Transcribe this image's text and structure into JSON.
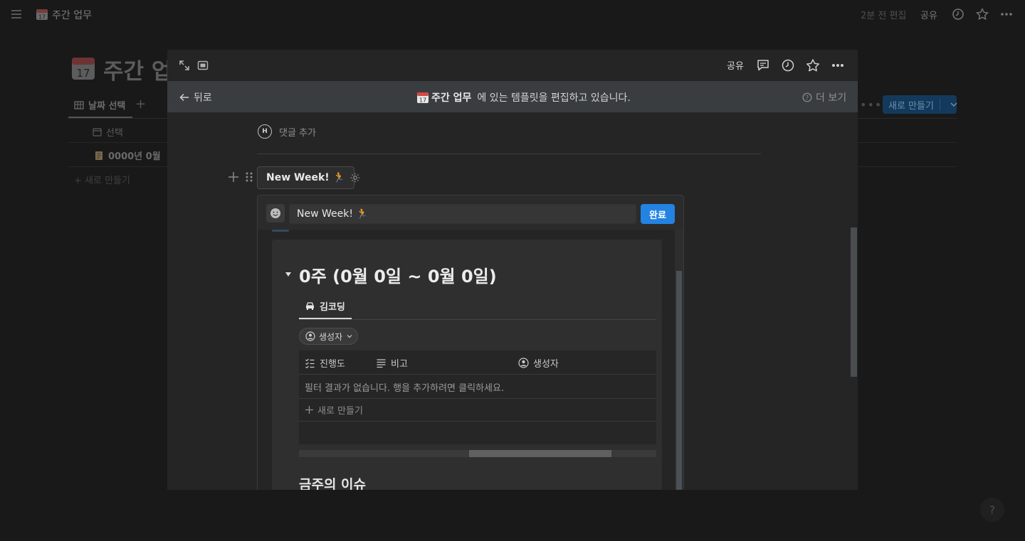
{
  "background": {
    "topbar": {
      "page_title": "주간 업무",
      "edited": "2분 전 편집",
      "share": "공유"
    },
    "page_title_big": "주간 업",
    "view_tab": "날짜 선택",
    "column_header": "선택",
    "row_title": "0000년 0월",
    "new_row": "새로 만들기",
    "new_button": "새로 만들기",
    "help": "?"
  },
  "modal": {
    "topbar": {
      "share": "공유"
    },
    "template_bar": {
      "back": "뒤로",
      "page_name": "주간 업무",
      "message": "에 있는 템플릿을 편집하고 있습니다.",
      "more": "더 보기"
    },
    "comment": {
      "avatar_initial": "H",
      "placeholder": "댓글 추가"
    },
    "template_button": {
      "label": "New Week! 🏃"
    },
    "editor": {
      "title_value": "New Week! 🏃",
      "done": "완료",
      "heading": "0주 (0월 0일 ~ 0월 0일)",
      "view_tab": "김코딩",
      "filter": "생성자",
      "columns": [
        "진행도",
        "비고",
        "생성자"
      ],
      "empty_message": "필터 결과가 없습니다. 행을 추가하려면 클릭하세요.",
      "new_row": "새로 만들기",
      "subheading": "금주의 이슈"
    }
  },
  "colors": {
    "accent": "#2383e2",
    "background": "#191919",
    "modal": "#252525",
    "template_bar": "#3a3d40"
  }
}
